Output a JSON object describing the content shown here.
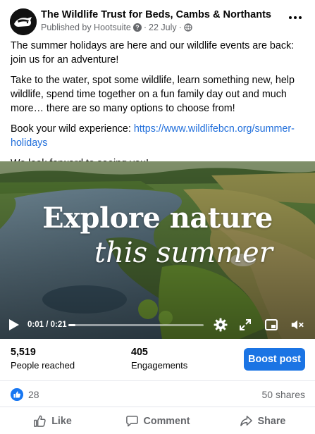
{
  "post": {
    "page_name": "The Wildlife Trust for Beds, Cambs & Northants",
    "published_by": "Published by Hootsuite",
    "date": "22 July",
    "separator": "·",
    "more_icon": "more-options-icon",
    "paragraphs": [
      "The summer holidays are here and our wildlife events are back: join us for an adventure!",
      "Take to the water, spot some wildlife, learn something new, help wildlife, spend time together on a fun family day out and much more… there are so many options to choose from!"
    ],
    "link_prefix": "Book your wild experience: ",
    "link_url": "https://www.wildlifebcn.org/summer-holidays",
    "closing": "We look forward to seeing you!"
  },
  "video": {
    "title_line1": "Explore nature",
    "title_line2": "this summer",
    "time": "0:01 / 0:21",
    "progress": 0.05,
    "icons": [
      "play-icon",
      "settings-icon",
      "fullscreen-icon",
      "picture-in-picture-icon",
      "volume-muted-icon"
    ]
  },
  "insights": {
    "reached_value": "5,519",
    "reached_label": "People reached",
    "engagements_value": "405",
    "engagements_label": "Engagements",
    "boost_label": "Boost post"
  },
  "social": {
    "reaction_count": "28",
    "shares": "50 shares"
  },
  "actions": {
    "like": "Like",
    "comment": "Comment",
    "share": "Share"
  },
  "colors": {
    "accent": "#1b74e4",
    "link": "#216fdb",
    "secondary_text": "#65676b"
  }
}
